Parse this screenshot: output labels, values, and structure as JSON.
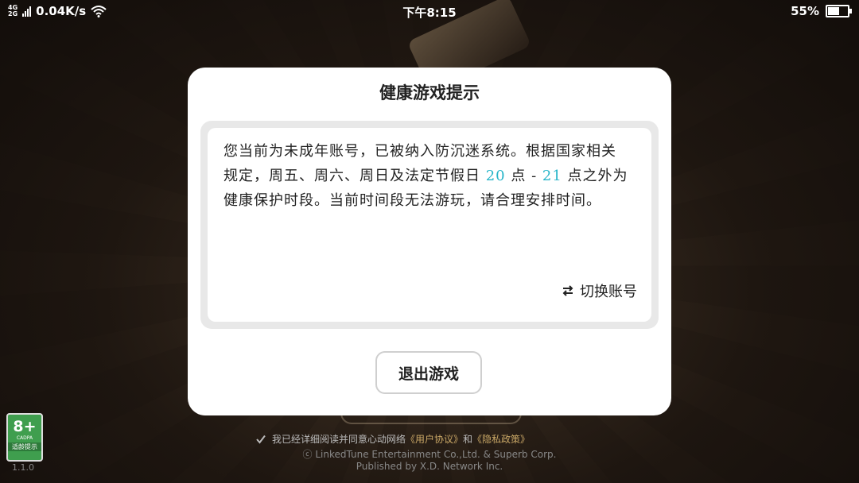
{
  "status_bar": {
    "network_type_top": "4G",
    "network_type_bottom": "2G",
    "speed": "0.04K/s",
    "time": "下午8:15",
    "battery_percent": "55%",
    "battery_level": 0.55
  },
  "dialog": {
    "title": "健康游戏提示",
    "message_part1": "您当前为未成年账号，已被纳入防沉迷系统。根据国家相关规定，周五、周六、周日及法定节假日 ",
    "highlight_start": "20",
    "message_part2": " 点 - ",
    "highlight_end": "21",
    "message_part3": " 点之外为健康保护时段。当前时间段无法游玩，请合理安排时间。",
    "switch_account_label": "切换账号",
    "exit_button_label": "退出游戏"
  },
  "footer": {
    "agreement_prefix": "我已经详细阅读并同意心动网络",
    "user_agreement": "《用户协议》",
    "and_text": "和",
    "privacy_policy": "《隐私政策》",
    "copyright_line1": "ⓒ LinkedTune Entertainment Co.,Ltd. & Superb Corp.",
    "copyright_line2": "Published by X.D. Network Inc.",
    "age_rating": "8+",
    "age_org": "CADPA",
    "age_tip": "适龄提示",
    "version": "1.1.0"
  },
  "colors": {
    "highlight": "#27b5c9",
    "link": "#c9a766",
    "age_badge": "#3f9e4e"
  }
}
